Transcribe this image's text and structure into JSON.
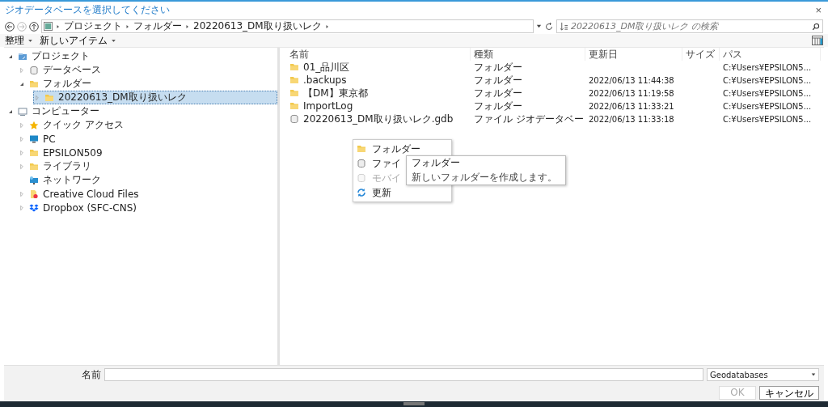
{
  "window": {
    "title": "ジオデータベースを選択してください",
    "close": "×"
  },
  "address_bar": {
    "crumbs": [
      "プロジェクト",
      "フォルダー",
      "20220613_DM取り扱いレク"
    ]
  },
  "search": {
    "placeholder": "20220613_DM取り扱いレク の検索"
  },
  "toolbar": [
    "整理",
    "新しいアイテム"
  ],
  "tree": [
    {
      "label": "プロジェクト",
      "kind": "project",
      "expanded": true,
      "selected": false,
      "children": [
        {
          "label": "データベース",
          "kind": "database",
          "expanded": false,
          "selected": false
        },
        {
          "label": "フォルダー",
          "kind": "folder",
          "expanded": true,
          "selected": false,
          "children": [
            {
              "label": "20220613_DM取り扱いレク",
              "kind": "folder",
              "expanded": false,
              "selected": true
            }
          ]
        }
      ]
    },
    {
      "label": "コンピューター",
      "kind": "computer",
      "expanded": true,
      "selected": false,
      "children": [
        {
          "label": "クイック アクセス",
          "kind": "star",
          "expanded": false,
          "selected": false
        },
        {
          "label": "PC",
          "kind": "pc",
          "expanded": false,
          "selected": false
        },
        {
          "label": "EPSILON509",
          "kind": "folder",
          "expanded": false,
          "selected": false
        },
        {
          "label": "ライブラリ",
          "kind": "folder",
          "expanded": false,
          "selected": false
        },
        {
          "label": "ネットワーク",
          "kind": "network",
          "selected": false
        },
        {
          "label": "Creative Cloud Files",
          "kind": "cloud",
          "expanded": false,
          "selected": false
        },
        {
          "label": "Dropbox (SFC-CNS)",
          "kind": "dropbox",
          "expanded": false,
          "selected": false
        }
      ]
    }
  ],
  "table": {
    "columns": [
      "名前",
      "種類",
      "更新日",
      "サイズ",
      "パス"
    ],
    "rows": [
      {
        "kind": "folder",
        "cells": [
          "01_品川区",
          "フォルダー",
          "",
          "",
          "C:¥Users¥EPSILON5..."
        ]
      },
      {
        "kind": "folder",
        "cells": [
          ".backups",
          "フォルダー",
          "2022/06/13 11:44:38",
          "",
          "C:¥Users¥EPSILON5..."
        ]
      },
      {
        "kind": "folder",
        "cells": [
          "【DM】東京都",
          "フォルダー",
          "2022/06/13 11:19:58",
          "",
          "C:¥Users¥EPSILON5..."
        ]
      },
      {
        "kind": "folder",
        "cells": [
          "ImportLog",
          "フォルダー",
          "2022/06/13 11:33:21",
          "",
          "C:¥Users¥EPSILON5..."
        ]
      },
      {
        "kind": "database",
        "cells": [
          "20220613_DM取り扱いレク.gdb",
          "ファイル ジオデータベー",
          "2022/06/13 11:33:18",
          "",
          "C:¥Users¥EPSILON5..."
        ]
      }
    ]
  },
  "context_menu": [
    {
      "label": "フォルダー",
      "kind": "folder",
      "disabled": false
    },
    {
      "label": "ファイ",
      "kind": "database",
      "disabled": false
    },
    {
      "label": "モバイ",
      "kind": "database",
      "disabled": true
    },
    {
      "label": "更新",
      "kind": "refresh",
      "disabled": false
    }
  ],
  "tooltip": {
    "title": "フォルダー",
    "text": "新しいフォルダーを作成します。"
  },
  "name_field": {
    "label": "名前"
  },
  "type_dropdown": {
    "value": "Geodatabases"
  },
  "buttons": [
    {
      "label": "OK",
      "disabled": true
    },
    {
      "label": "キャンセル",
      "disabled": false
    }
  ]
}
